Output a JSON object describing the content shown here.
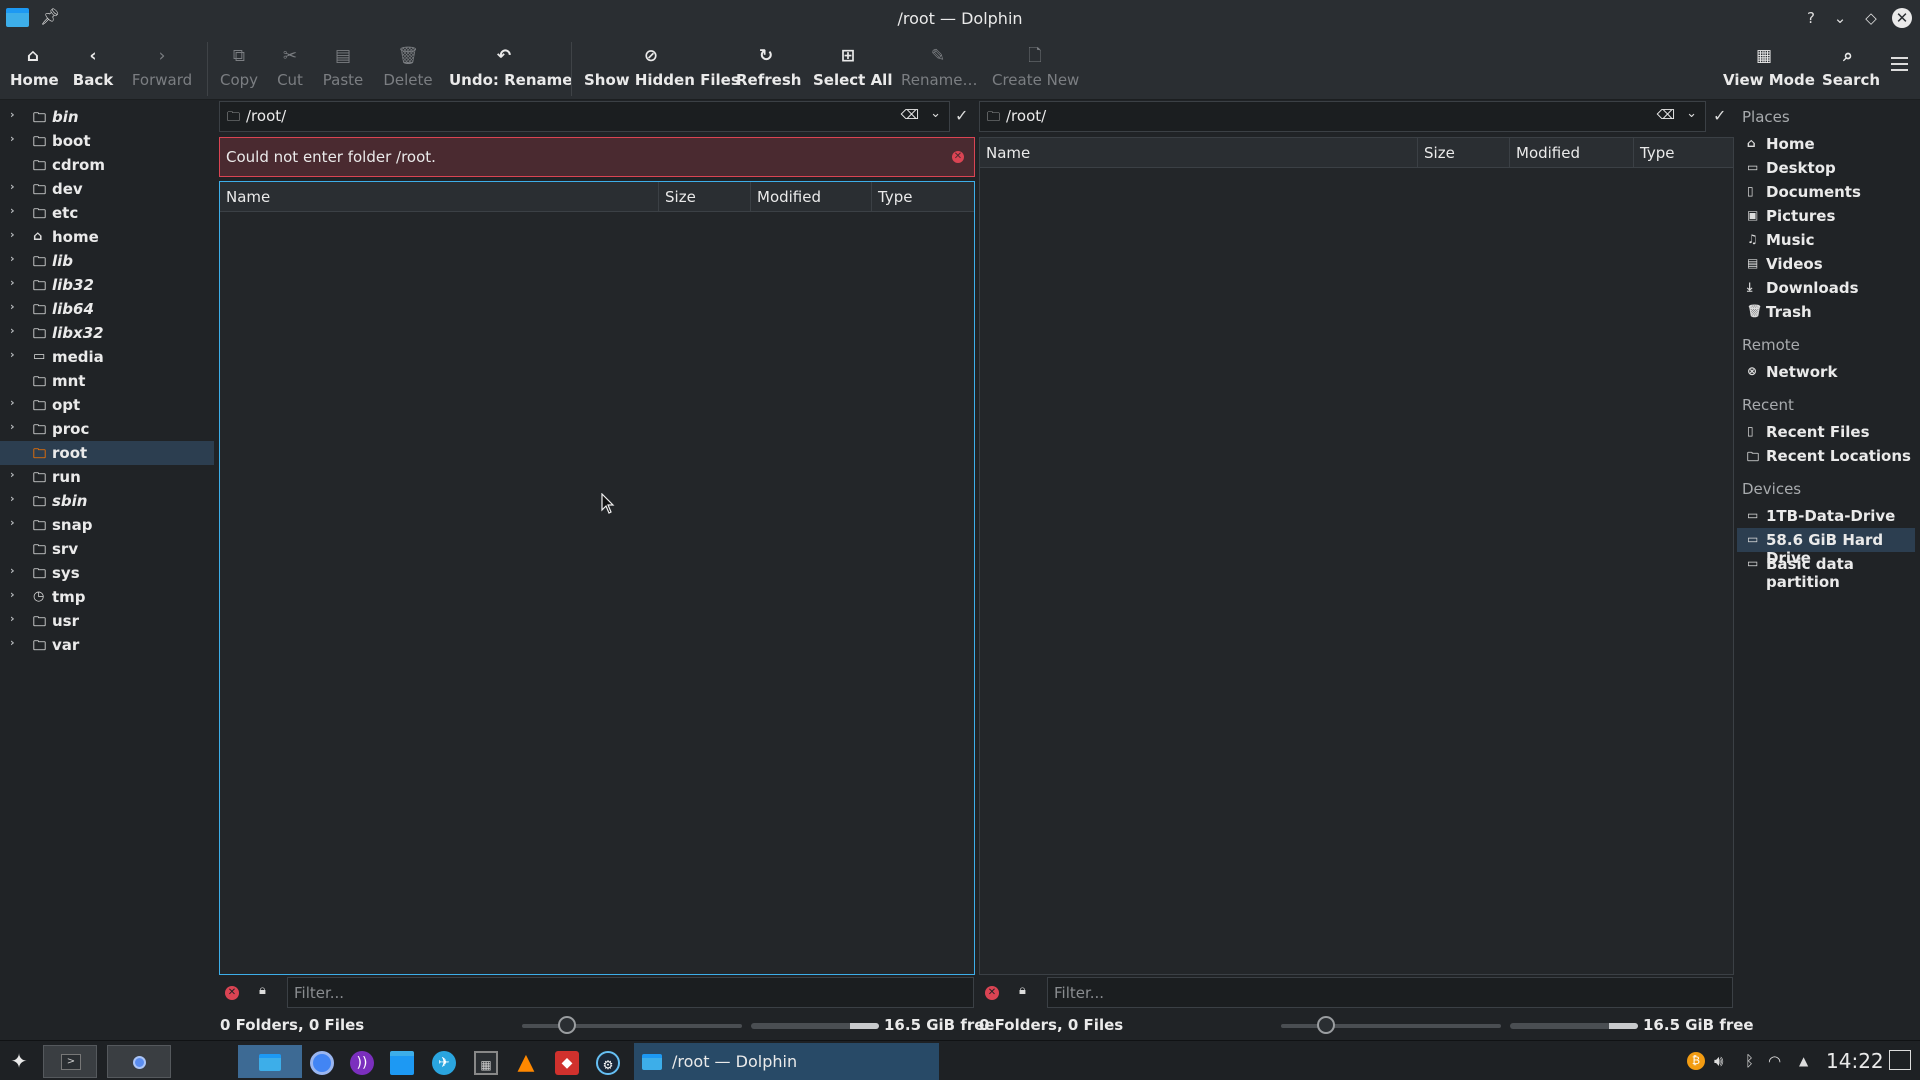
{
  "window": {
    "title": "/root — Dolphin"
  },
  "toolbar": {
    "home": "Home",
    "back": "Back",
    "forward": "Forward",
    "copy": "Copy",
    "cut": "Cut",
    "paste": "Paste",
    "delete": "Delete",
    "undo": "Undo: Rename",
    "show_hidden": "Show Hidden Files",
    "refresh": "Refresh",
    "select_all": "Select All",
    "rename": "Rename…",
    "create_new": "Create New",
    "view_mode": "View Mode",
    "search": "Search"
  },
  "tree": {
    "items": [
      {
        "label": "bin"
      },
      {
        "label": "boot"
      },
      {
        "label": "cdrom"
      },
      {
        "label": "dev"
      },
      {
        "label": "etc"
      },
      {
        "label": "home"
      },
      {
        "label": "lib"
      },
      {
        "label": "lib32"
      },
      {
        "label": "lib64"
      },
      {
        "label": "libx32"
      },
      {
        "label": "media"
      },
      {
        "label": "mnt"
      },
      {
        "label": "opt"
      },
      {
        "label": "proc"
      },
      {
        "label": "root"
      },
      {
        "label": "run"
      },
      {
        "label": "sbin"
      },
      {
        "label": "snap"
      },
      {
        "label": "srv"
      },
      {
        "label": "sys"
      },
      {
        "label": "tmp"
      },
      {
        "label": "usr"
      },
      {
        "label": "var"
      }
    ]
  },
  "left_pane": {
    "path": "/root/",
    "error": "Could not enter folder /root.",
    "columns": [
      "Name",
      "Size",
      "Modified",
      "Type"
    ],
    "filter_placeholder": "Filter...",
    "status": "0 Folders, 0 Files",
    "free": "16.5 GiB free"
  },
  "right_pane": {
    "path": "/root/",
    "columns": [
      "Name",
      "Size",
      "Modified",
      "Type"
    ],
    "filter_placeholder": "Filter...",
    "status": "0 Folders, 0 Files",
    "free": "16.5 GiB free"
  },
  "places": {
    "places_title": "Places",
    "places": [
      "Home",
      "Desktop",
      "Documents",
      "Pictures",
      "Music",
      "Videos",
      "Downloads",
      "Trash"
    ],
    "remote_title": "Remote",
    "remote": [
      "Network"
    ],
    "recent_title": "Recent",
    "recent": [
      "Recent Files",
      "Recent Locations"
    ],
    "devices_title": "Devices",
    "devices": [
      "1TB-Data-Drive",
      "58.6 GiB Hard Drive",
      "Basic data partition"
    ]
  },
  "taskbar": {
    "task_title": "/root — Dolphin",
    "clock": "14:22"
  },
  "colors": {
    "accent": "#3daee9",
    "error": "#da4453",
    "selection": "#2c3e50"
  }
}
